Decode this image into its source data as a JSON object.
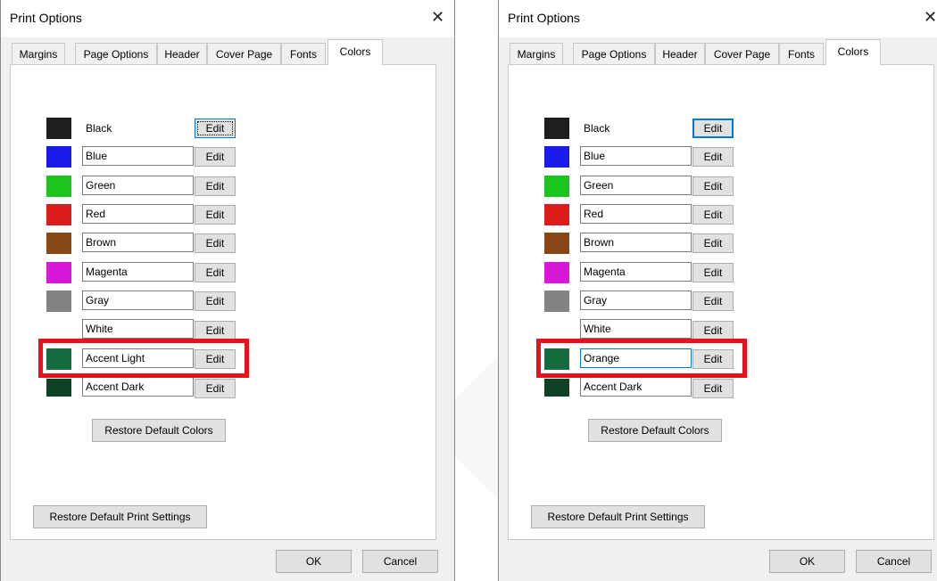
{
  "left": {
    "title": "Print Options",
    "tabs": [
      "Margins",
      "Page Options",
      "Header",
      "Cover Page",
      "Fonts",
      "Colors"
    ],
    "active_tab": "Colors",
    "colors": [
      {
        "name": "Black",
        "swatch": "#1e1e1e"
      },
      {
        "name": "Blue",
        "swatch": "#1b1be9"
      },
      {
        "name": "Green",
        "swatch": "#1dc41d"
      },
      {
        "name": "Red",
        "swatch": "#dc1b1b"
      },
      {
        "name": "Brown",
        "swatch": "#874717"
      },
      {
        "name": "Magenta",
        "swatch": "#d817d8"
      },
      {
        "name": "Gray",
        "swatch": "#838383"
      },
      {
        "name": "White",
        "swatch": "#ffffff"
      },
      {
        "name": "Accent Light",
        "swatch": "#156c3e"
      },
      {
        "name": "Accent Dark",
        "swatch": "#0d4225"
      }
    ],
    "edit_label": "Edit",
    "restore_colors_label": "Restore Default Colors",
    "restore_print_label": "Restore Default Print Settings",
    "ok_label": "OK",
    "cancel_label": "Cancel",
    "highlight_color": "#e8121c"
  },
  "right": {
    "title": "Print Options",
    "tabs": [
      "Margins",
      "Page Options",
      "Header",
      "Cover Page",
      "Fonts",
      "Colors"
    ],
    "active_tab": "Colors",
    "colors": [
      {
        "name": "Black",
        "swatch": "#1e1e1e"
      },
      {
        "name": "Blue",
        "swatch": "#1b1be9"
      },
      {
        "name": "Green",
        "swatch": "#1dc41d"
      },
      {
        "name": "Red",
        "swatch": "#dc1b1b"
      },
      {
        "name": "Brown",
        "swatch": "#874717"
      },
      {
        "name": "Magenta",
        "swatch": "#d817d8"
      },
      {
        "name": "Gray",
        "swatch": "#838383"
      },
      {
        "name": "White",
        "swatch": "#ffffff"
      },
      {
        "name": "Orange",
        "swatch": "#156c3e"
      },
      {
        "name": "Accent Dark",
        "swatch": "#0d4225"
      }
    ],
    "edit_label": "Edit",
    "restore_colors_label": "Restore Default Colors",
    "restore_print_label": "Restore Default Print Settings",
    "ok_label": "OK",
    "cancel_label": "Cancel",
    "highlight_color": "#e8121c"
  },
  "close_glyph": "✕"
}
